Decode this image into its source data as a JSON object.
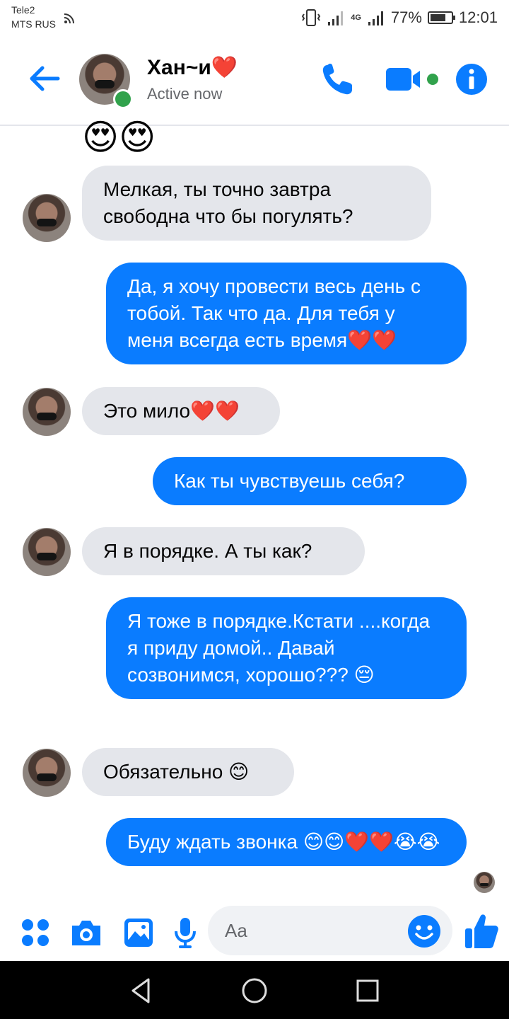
{
  "status_bar": {
    "carrier1": "Tele2",
    "carrier2": "MTS RUS",
    "network": "4G",
    "battery": "77%",
    "battery_level": 0.77,
    "time": "12:01"
  },
  "header": {
    "name": "Хан~и❤️",
    "status": "Active now",
    "accent": "#0a7cff",
    "online_color": "#31a24c"
  },
  "chat": {
    "top_emojis": "😍😍",
    "messages": [
      {
        "from": "them",
        "text": "Мелкая, ты точно завтра свободна что бы погулять?"
      },
      {
        "from": "me",
        "text": "Да, я хочу провести весь день с тобой. Так что да. Для тебя у меня всегда есть время❤️❤️"
      },
      {
        "from": "them",
        "text": "Это мило❤️❤️"
      },
      {
        "from": "me",
        "text": "Как ты чувствуешь себя?"
      },
      {
        "from": "them",
        "text": "Я в порядке. А ты как?"
      },
      {
        "from": "me",
        "text": "Я тоже в порядке.Кстати ....когда я приду домой.. Давай созвонимся, хорошо??? 😔"
      },
      {
        "from": "them",
        "text": "Обязательно 😊"
      },
      {
        "from": "me",
        "text": "Буду ждать звонка 😊😊❤️❤️😭😭"
      }
    ]
  },
  "composer": {
    "placeholder": "Aa"
  },
  "icons": {
    "back": "back-arrow-icon",
    "call": "phone-icon",
    "video": "video-camera-icon",
    "info": "info-icon",
    "menu": "four-dots-icon",
    "camera": "camera-icon",
    "gallery": "image-icon",
    "mic": "microphone-icon",
    "emoji": "smiley-icon",
    "like": "thumbs-up-icon"
  }
}
